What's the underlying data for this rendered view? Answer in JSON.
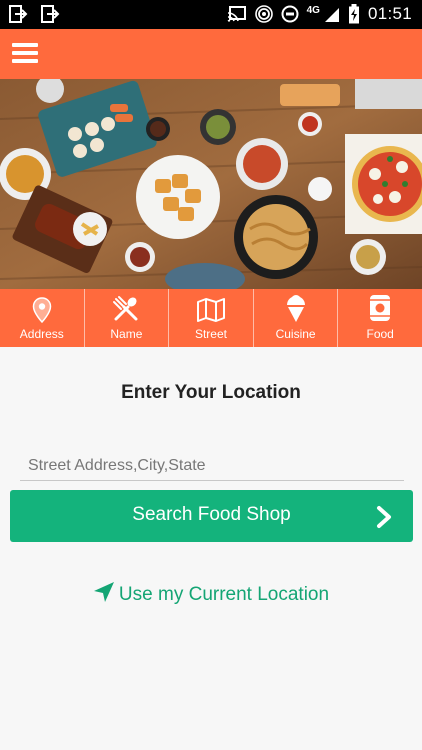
{
  "status_bar": {
    "time": "01:51",
    "network": "4G",
    "icons": [
      "cast-icon",
      "hotspot-icon",
      "sync-icon",
      "signal-icon",
      "battery-icon"
    ]
  },
  "app_bar": {
    "menu_icon": "hamburger-menu-icon",
    "color": "#ff6a3d"
  },
  "banner": {
    "image": "food-table-photo"
  },
  "tabs": [
    {
      "label": "Address",
      "icon": "location-pin-icon"
    },
    {
      "label": "Name",
      "icon": "fork-spoon-icon"
    },
    {
      "label": "Street",
      "icon": "map-icon"
    },
    {
      "label": "Cuisine",
      "icon": "ice-cream-icon"
    },
    {
      "label": "Food",
      "icon": "can-icon"
    }
  ],
  "main": {
    "title": "Enter Your Location",
    "address_placeholder": "Street Address,City,State",
    "search_button": "Search Food Shop",
    "current_location": "Use my Current Location"
  },
  "colors": {
    "primary": "#ff6a3d",
    "accent": "#14b37c",
    "link": "#14a574"
  }
}
